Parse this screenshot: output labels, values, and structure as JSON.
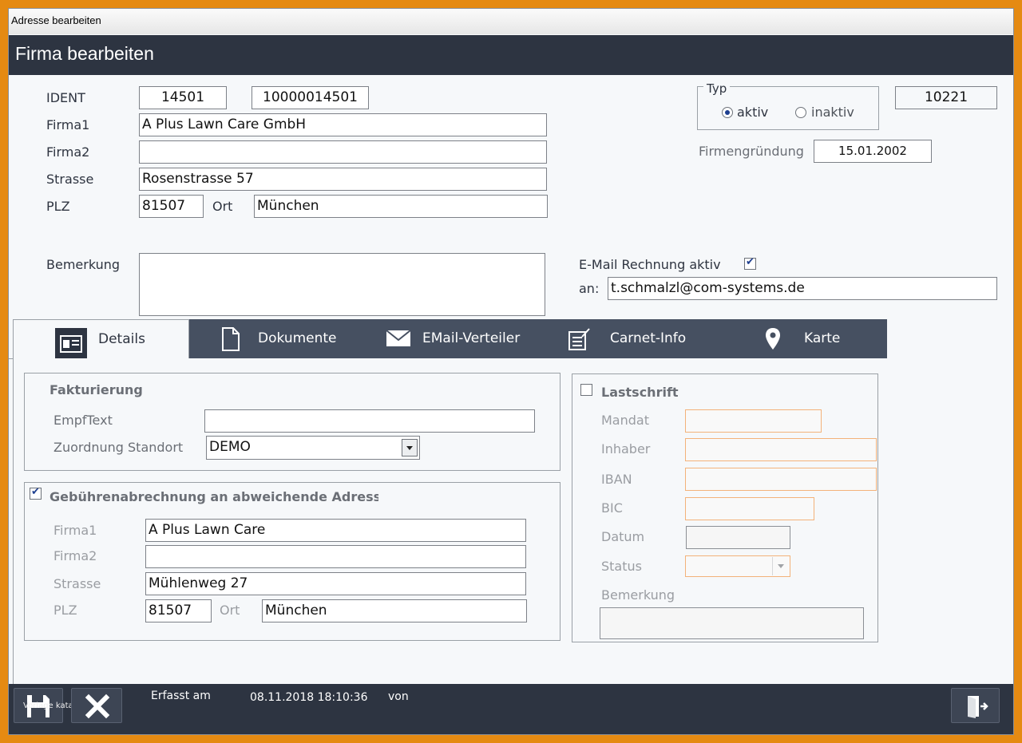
{
  "window": {
    "title": "Adresse bearbeiten",
    "header": "Firma bearbeiten"
  },
  "main": {
    "ident_label": "IDENT",
    "ident_value": "14501",
    "ident_value2": "10000014501",
    "firma1_label": "Firma1",
    "firma1_value": "A Plus Lawn Care GmbH",
    "firma2_label": "Firma2",
    "firma2_value": "",
    "strasse_label": "Strasse",
    "strasse_value": "Rosenstrasse 57",
    "plz_label": "PLZ",
    "plz_value": "81507",
    "ort_label": "Ort",
    "ort_value": "München",
    "bemerkung_label": "Bemerkung",
    "bemerkung_value": ""
  },
  "typ": {
    "legend": "Typ",
    "options": [
      "aktiv",
      "inaktiv"
    ],
    "selected": "aktiv",
    "number": "10221",
    "gruendung_label": "Firmengründung",
    "gruendung_value": "15.01.2002"
  },
  "email": {
    "label": "E-Mail Rechnung aktiv",
    "checked": true,
    "an_label": "an:",
    "an_value": "t.schmalzl@com-systems.de"
  },
  "tabs": [
    {
      "label": "Details",
      "icon": "id-card-icon",
      "active": true
    },
    {
      "label": "Dokumente",
      "icon": "document-icon"
    },
    {
      "label": "EMail-Verteiler",
      "icon": "envelope-icon"
    },
    {
      "label": "Carnet-Info",
      "icon": "notepad-icon"
    },
    {
      "label": "Karte",
      "icon": "map-pin-icon"
    }
  ],
  "fakturierung": {
    "title": "Fakturierung",
    "empftext_label": "EmpfText",
    "empftext_value": "",
    "standort_label": "Zuordnung Standort",
    "standort_value": "DEMO"
  },
  "gebuehren": {
    "title": "Gebührenabrechnung an abweichende Adresse",
    "checked": true,
    "firma1_label": "Firma1",
    "firma1_value": "A Plus Lawn Care",
    "firma2_label": "Firma2",
    "firma2_value": "",
    "strasse_label": "Strasse",
    "strasse_value": "Mühlenweg 27",
    "plz_label": "PLZ",
    "plz_value": "81507",
    "ort_label": "Ort",
    "ort_value": "München"
  },
  "lastschrift": {
    "title": "Lastschrift",
    "checked": false,
    "mandat_label": "Mandat",
    "inhaber_label": "Inhaber",
    "iban_label": "IBAN",
    "bic_label": "BIC",
    "datum_label": "Datum",
    "status_label": "Status",
    "bemerkung_label": "Bemerkung"
  },
  "footer": {
    "overlay_text": "Vorlage katalog",
    "erfasst_label": "Erfasst am",
    "erfasst_value": "08.11.2018 18:10:36",
    "von_label": "von"
  },
  "colors": {
    "header_bg": "#2d3441",
    "tab_bg": "#465061",
    "accent_orange": "#f3b27a",
    "frame_orange": "#e58a12"
  }
}
